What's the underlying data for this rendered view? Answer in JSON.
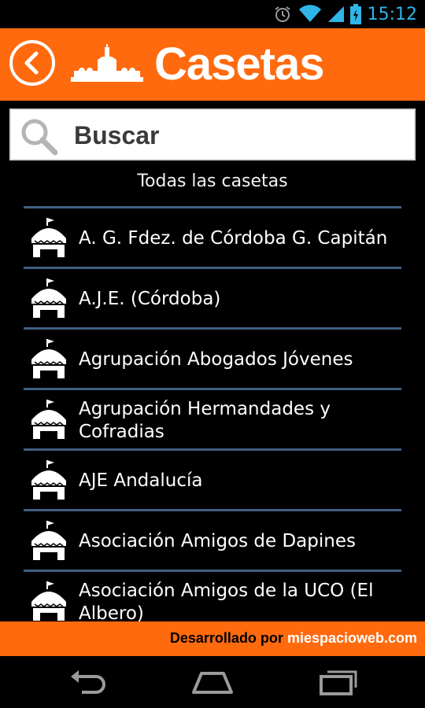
{
  "status_bar": {
    "time": "15:12",
    "icons": [
      "alarm-icon",
      "wifi-icon",
      "signal-icon",
      "battery-icon"
    ]
  },
  "header": {
    "title": "Casetas",
    "back_icon": "chevron-left-icon",
    "logo_icon": "mezquita-skyline-icon",
    "background_color": "#ff6a0e"
  },
  "search": {
    "placeholder": "Buscar",
    "value": ""
  },
  "list": {
    "heading": "Todas las casetas",
    "item_icon": "caseta-tent-icon",
    "items": [
      {
        "label": "A. G. Fdez. de Córdoba G. Capitán"
      },
      {
        "label": "A.J.E. (Córdoba)"
      },
      {
        "label": "Agrupación Abogados Jóvenes"
      },
      {
        "label": "Agrupación Hermandades y Cofradias"
      },
      {
        "label": "AJE Andalucía"
      },
      {
        "label": "Asociación Amigos de Dapines"
      },
      {
        "label": "Asociación Amigos de la UCO (El Albero)"
      }
    ]
  },
  "footer": {
    "prefix": "Desarrollado por ",
    "brand": "miespacioweb.com"
  },
  "nav_bar": {
    "buttons": [
      "back-nav-icon",
      "home-nav-icon",
      "recent-apps-icon"
    ]
  }
}
